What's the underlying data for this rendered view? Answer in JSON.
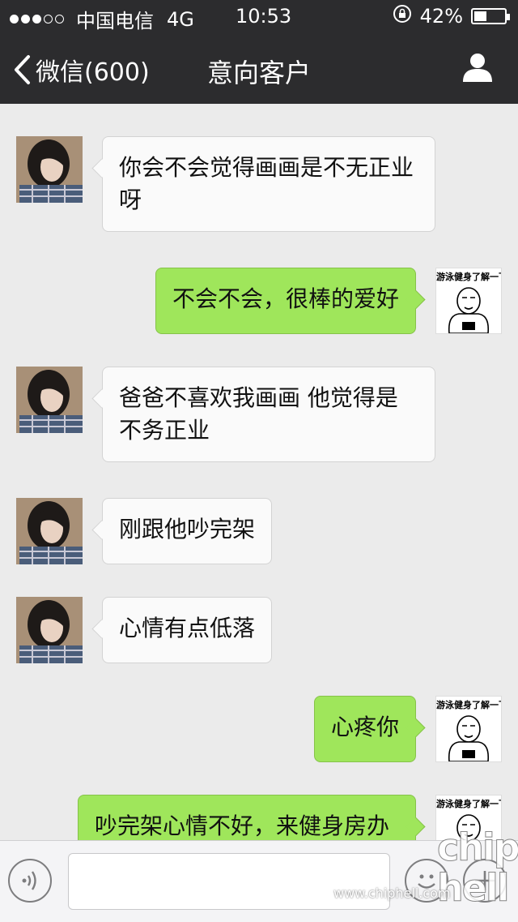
{
  "status_bar": {
    "carrier": "中国电信",
    "network": "4G",
    "time": "10:53",
    "battery": "42%",
    "battery_level": 0.42
  },
  "nav": {
    "back_label": "微信(600)",
    "title": "意向客户"
  },
  "messages": [
    {
      "side": "in",
      "text": "你会不会觉得画画是不无正业呀"
    },
    {
      "side": "out",
      "text": "不会不会，很棒的爱好",
      "sticker_caption": "游泳健身了解一下"
    },
    {
      "side": "in",
      "text": "爸爸不喜欢我画画 他觉得是不务正业"
    },
    {
      "side": "in",
      "text": "刚跟他吵完架"
    },
    {
      "side": "in",
      "text": "心情有点低落"
    },
    {
      "side": "out",
      "text": "心疼你",
      "sticker_caption": "游泳健身了解一下"
    },
    {
      "side": "out",
      "text": "吵完架心情不好，来健身房办",
      "sticker_caption": "游泳健身了解一下"
    }
  ],
  "input": {
    "value": "",
    "placeholder": ""
  },
  "watermark": {
    "logo": "chip\nhell",
    "url": "www.chiphell.com"
  },
  "colors": {
    "header_bg": "#2c2c2e",
    "chat_bg": "#ebebeb",
    "outgoing_bubble": "#9fe65b",
    "incoming_bubble": "#fafafa"
  }
}
